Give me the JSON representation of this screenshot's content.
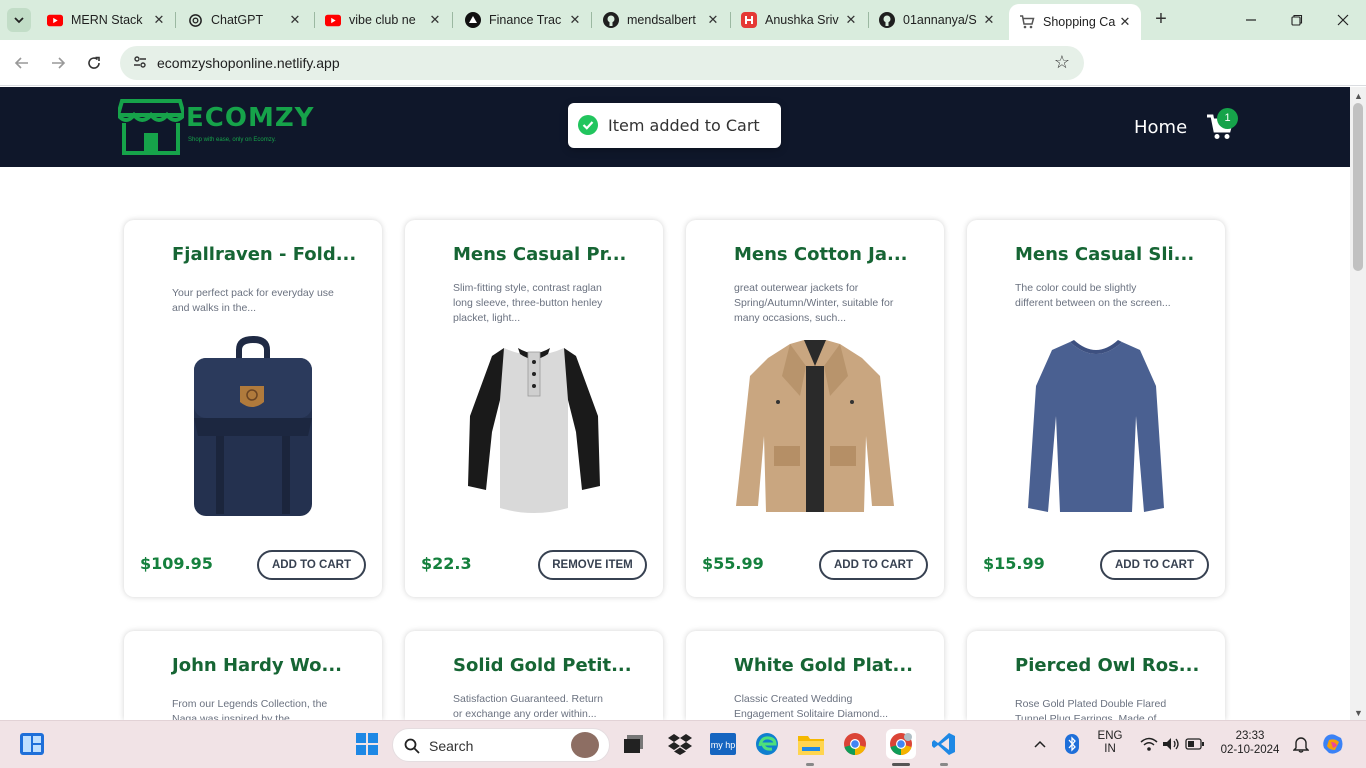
{
  "browser": {
    "tabs": [
      {
        "title": "MERN Stack",
        "icon": "youtube-icon"
      },
      {
        "title": "ChatGPT",
        "icon": "chatgpt-icon"
      },
      {
        "title": "vibe club ne",
        "icon": "youtube-icon"
      },
      {
        "title": "Finance Trac",
        "icon": "vercel-icon"
      },
      {
        "title": "mendsalbert",
        "icon": "github-icon"
      },
      {
        "title": "Anushka Sriv",
        "icon": "hashnode-icon"
      },
      {
        "title": "01annanya/S",
        "icon": "github-icon"
      },
      {
        "title": "Shopping Ca",
        "icon": "cart-icon",
        "active": true
      }
    ],
    "url": "ecomzyshoponline.netlify.app"
  },
  "site": {
    "logo_text": "ECOMZY",
    "logo_tagline": "Shop with ease, only on Ecomzy.",
    "nav_home": "Home",
    "cart_count": "1",
    "toast": "Item added to Cart",
    "brand_color": "#16a34a",
    "header_bg": "#0f172a"
  },
  "products": [
    {
      "title": "Fjallraven - Fold...",
      "desc": "Your perfect pack for everyday use and walks in the...",
      "price": "$109.95",
      "button": "ADD TO CART",
      "image": "backpack"
    },
    {
      "title": "Mens Casual Pr...",
      "desc": "Slim-fitting style, contrast raglan long sleeve, three-button henley placket, light...",
      "price": "$22.3",
      "button": "REMOVE ITEM",
      "image": "raglan-tshirt"
    },
    {
      "title": "Mens Cotton Ja...",
      "desc": "great outerwear jackets for Spring/Autumn/Winter, suitable for many occasions, such...",
      "price": "$55.99",
      "button": "ADD TO CART",
      "image": "cotton-jacket"
    },
    {
      "title": "Mens Casual Sli...",
      "desc": "The color could be slightly different between on the screen...",
      "price": "$15.99",
      "button": "ADD TO CART",
      "image": "slim-tshirt"
    },
    {
      "title": "John Hardy Wo...",
      "desc": "From our Legends Collection, the Naga was inspired by the..."
    },
    {
      "title": "Solid Gold Petit...",
      "desc": "Satisfaction Guaranteed. Return or exchange any order within..."
    },
    {
      "title": "White Gold Plat...",
      "desc": "Classic Created Wedding Engagement Solitaire Diamond..."
    },
    {
      "title": "Pierced Owl Ros...",
      "desc": "Rose Gold Plated Double Flared Tunnel Plug Earrings. Made of..."
    }
  ],
  "taskbar": {
    "search_placeholder": "Search",
    "lang_top": "ENG",
    "lang_bottom": "IN",
    "time": "23:33",
    "date": "02-10-2024"
  }
}
